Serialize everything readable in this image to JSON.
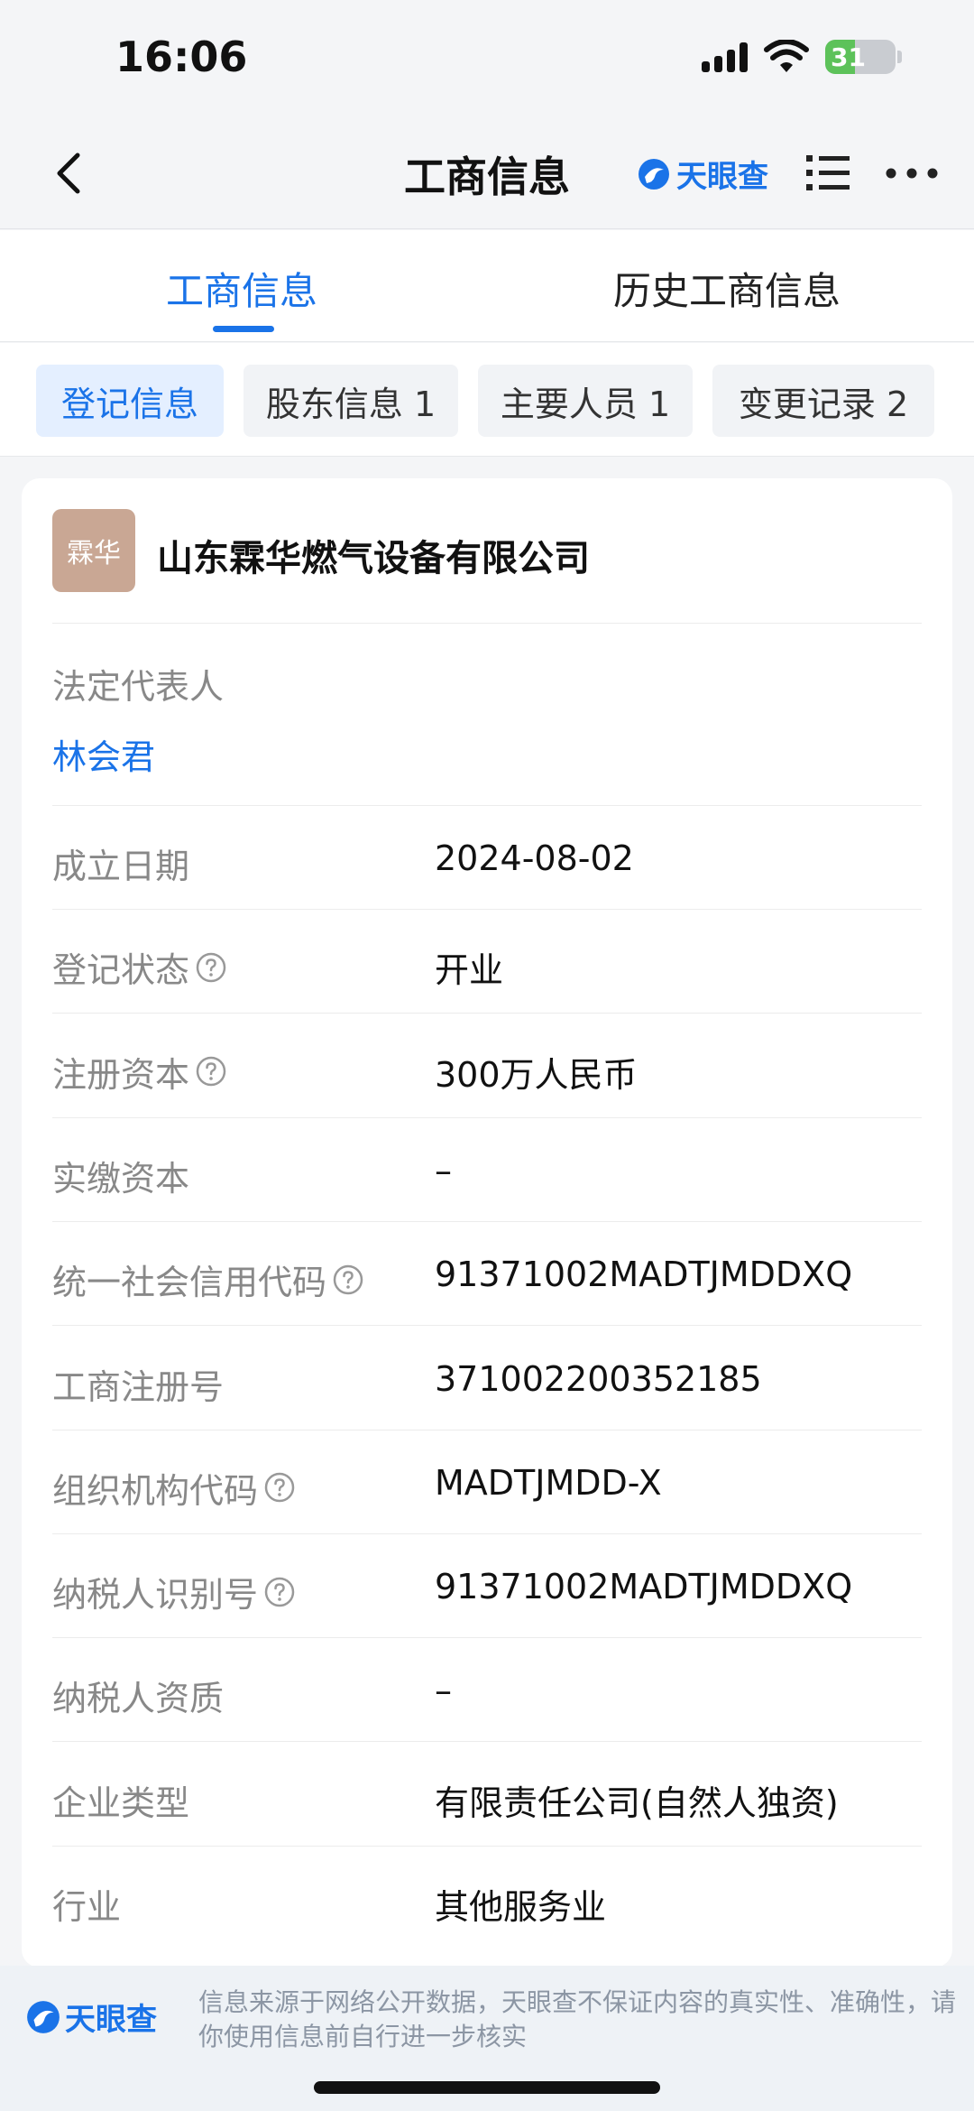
{
  "status_bar": {
    "time": "16:06",
    "battery": "31"
  },
  "nav": {
    "title": "工商信息",
    "brand": "天眼查"
  },
  "tabs": [
    {
      "label": "工商信息",
      "active": true
    },
    {
      "label": "历史工商信息",
      "active": false
    }
  ],
  "subtabs": [
    {
      "label": "登记信息",
      "active": true
    },
    {
      "label": "股东信息 1",
      "active": false
    },
    {
      "label": "主要人员 1",
      "active": false
    },
    {
      "label": "变更记录 2",
      "active": false
    }
  ],
  "company": {
    "logo_text": "霖华",
    "name": "山东霖华燃气设备有限公司",
    "legal_rep_label": "法定代表人",
    "legal_rep": "林会君"
  },
  "details": [
    {
      "label": "成立日期",
      "value": "2024-08-02",
      "help": false
    },
    {
      "label": "登记状态",
      "value": "开业",
      "help": true
    },
    {
      "label": "注册资本",
      "value": "300万人民币",
      "help": true
    },
    {
      "label": "实缴资本",
      "value": "–",
      "help": false
    },
    {
      "label": "统一社会信用代码",
      "value": "91371002MADTJMDDXQ",
      "help": true
    },
    {
      "label": "工商注册号",
      "value": "371002200352185",
      "help": false
    },
    {
      "label": "组织机构代码",
      "value": "MADTJMDD-X",
      "help": true
    },
    {
      "label": "纳税人识别号",
      "value": "91371002MADTJMDDXQ",
      "help": true
    },
    {
      "label": "纳税人资质",
      "value": "–",
      "help": false
    },
    {
      "label": "企业类型",
      "value": "有限责任公司(自然人独资)",
      "help": false
    },
    {
      "label": "行业",
      "value": "其他服务业",
      "help": false
    }
  ],
  "footer": {
    "brand": "天眼查",
    "disclaimer": "信息来源于网络公开数据，天眼查不保证内容的真实性、准确性，请你使用信息前自行进一步核实"
  },
  "colors": {
    "accent": "#1a73e8",
    "logo_bg": "#c9a794",
    "battery": "#5dc25a"
  }
}
